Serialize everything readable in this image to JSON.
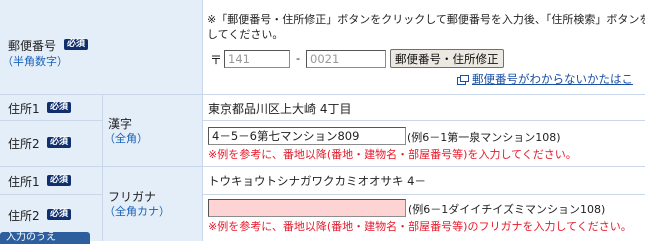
{
  "postal": {
    "label": "郵便番号",
    "required": "必須",
    "sub": "（半角数字）",
    "instruction_1": "※「郵便番号・住所修正」ボタンをクリックして郵便番号を入力後、「住所検索」ボタンをクリ",
    "instruction_2": "してください。",
    "mark": "〒",
    "first_value": "141",
    "dash": "-",
    "second_value": "0021",
    "fix_button": "郵便番号・住所修正",
    "unknown_link": "郵便番号がわからないかたはこ"
  },
  "kanji": {
    "addr1_label": "住所1",
    "addr2_label": "住所2",
    "required": "必須",
    "group_label": "漢字",
    "group_sub": "（全角）",
    "addr1_value": "東京都品川区上大崎 4丁目",
    "addr2_value": "4－5－6第七マンション809",
    "example": "(例6－1第一泉マンション108)",
    "note": "※例を参考に、番地以降(番地・建物名・部屋番号等)を入力してください。"
  },
  "kana": {
    "addr1_label": "住所1",
    "addr2_label": "住所2",
    "required": "必須",
    "group_label": "フリガナ",
    "group_sub": "（全角カナ）",
    "addr1_value": "トウキョウトシナガワクカミオオサキ 4－",
    "addr2_value": "",
    "example": "(例6－1ダイイチイズミマンション108)",
    "note": "※例を参考に、番地以降(番地・建物名・部屋番号等)のフリガナを入力してください。"
  },
  "footer_tab": "入力のうえ",
  "colors": {
    "header_bg": "#e4eef9",
    "badge": "#102f6e",
    "link": "#1a4fa6",
    "error": "#e8182a",
    "pink_input": "#fdd3d3"
  }
}
